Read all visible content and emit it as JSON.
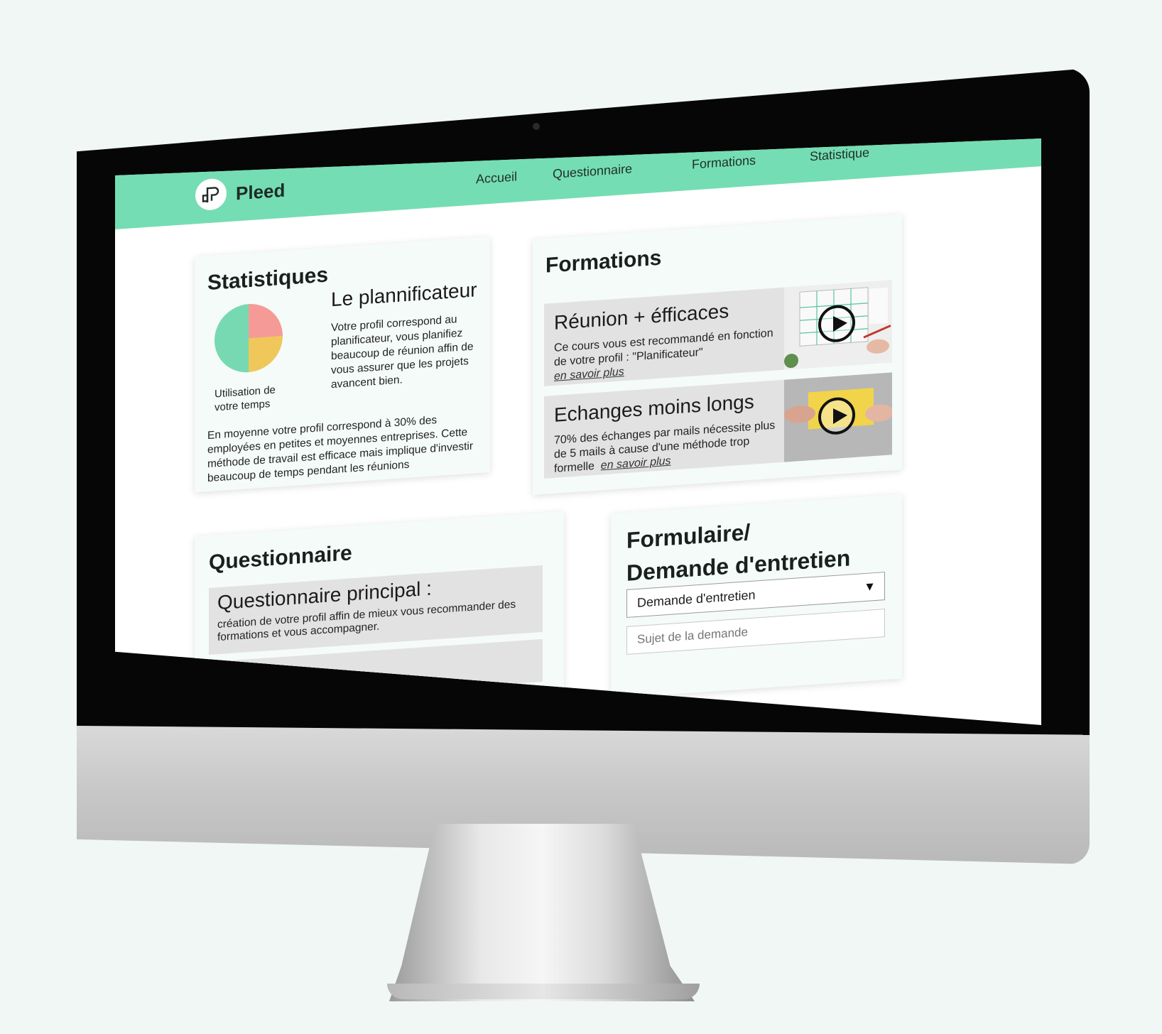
{
  "navbar": {
    "brand": "Pleed",
    "items": [
      "Accueil",
      "Questionnaire",
      "Formations",
      "Statistique"
    ]
  },
  "statistics": {
    "title": "Statistiques",
    "profile_title": "Le plannificateur",
    "profile_description": "Votre profil correspond au planificateur, vous planifiez beaucoup de réunion affin de vous assurer que les projets avancent bien.",
    "pie_label": "Utilisation de votre temps",
    "note": "En moyenne votre profil correspond à 30% des employées en petites et moyennes entreprises. Cette méthode de travail est efficace mais implique d'investir beaucoup de temps pendant les réunions"
  },
  "formations": {
    "title": "Formations",
    "items": [
      {
        "title": "Réunion + éfficaces",
        "description": "Ce cours vous est recommandé en fonction de votre profil : \"Planificateur\"",
        "link": "en savoir plus"
      },
      {
        "title": "Echanges moins longs",
        "description": "70% des échanges par mails nécessite plus de 5 mails à cause d'une méthode trop formelle",
        "link": "en savoir plus"
      }
    ]
  },
  "questionnaire": {
    "title": "Questionnaire",
    "items": [
      {
        "title": "Questionnaire principal :",
        "description": "création de votre profil affin de mieux vous recommander des formations et vous accompagner."
      }
    ]
  },
  "form": {
    "title_line1": "Formulaire/",
    "title_line2": "Demande d'entretien",
    "select_value": "Demande d'entretien",
    "subject_placeholder": "Sujet de la demande"
  },
  "colors": {
    "accent": "#75ddb3",
    "pie": [
      "#f59a96",
      "#f0c75a",
      "#77d9b2"
    ]
  }
}
